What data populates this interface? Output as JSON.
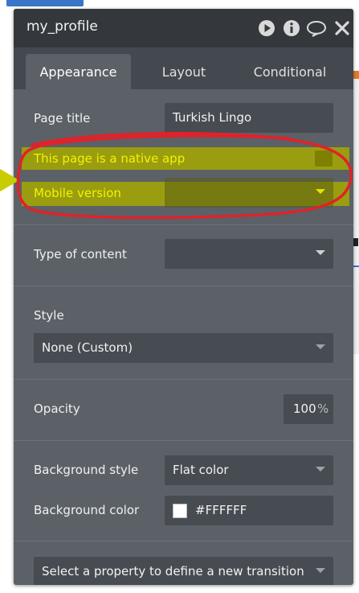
{
  "window": {
    "title": "my_profile"
  },
  "title_icons": [
    "play-icon",
    "info-icon",
    "comment-icon",
    "close-icon"
  ],
  "tabs": [
    {
      "label": "Appearance",
      "active": true
    },
    {
      "label": "Layout",
      "active": false
    },
    {
      "label": "Conditional",
      "active": false
    }
  ],
  "fields": {
    "page_title_label": "Page title",
    "page_title_value": "Turkish Lingo",
    "native_app_label": "This page is a native app",
    "mobile_version_label": "Mobile version",
    "mobile_version_value": "",
    "type_of_content_label": "Type of content",
    "type_of_content_value": "",
    "style_label": "Style",
    "style_value": "None (Custom)",
    "opacity_label": "Opacity",
    "opacity_value": "100",
    "opacity_unit": "%",
    "background_style_label": "Background style",
    "background_style_value": "Flat color",
    "background_color_label": "Background color",
    "background_color_value": "#FFFFFF",
    "transition_placeholder": "Select a property to define a new transition"
  },
  "colors": {
    "panel": "#5b6167",
    "titlebar": "#34383d",
    "annotation_red": "#e0222a",
    "annotation_yellow": "#a6a800"
  }
}
